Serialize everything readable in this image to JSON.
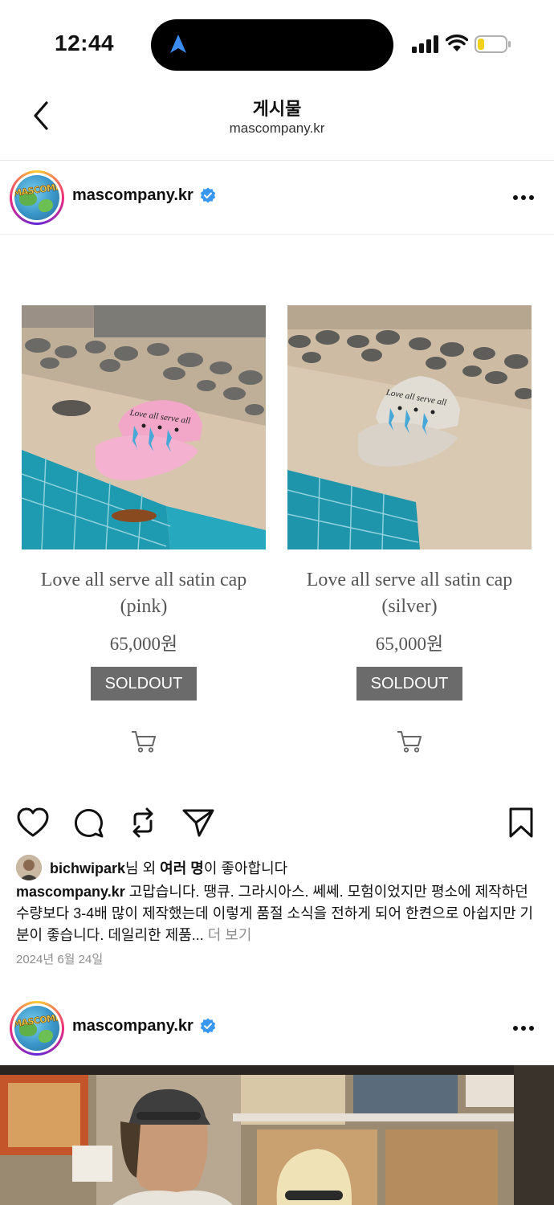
{
  "status_bar": {
    "time": "12:44"
  },
  "header": {
    "title": "게시물",
    "subtitle": "mascompany.kr",
    "back_icon": "chevron-left-icon"
  },
  "post": {
    "username": "mascompany.kr",
    "avatar_text": "MASCOMPANY",
    "verified": true,
    "products": [
      {
        "name_line1": "Love all serve all satin cap",
        "name_line2": "(pink)",
        "price": "65,000원",
        "status": "SOLDOUT",
        "cap_color": "#f2a7c8"
      },
      {
        "name_line1": "Love all serve all satin cap",
        "name_line2": "(silver)",
        "price": "65,000원",
        "status": "SOLDOUT",
        "cap_color": "#d8d2c8"
      }
    ],
    "cap_print_text": "Love all serve all",
    "likes": {
      "user": "bichwipark",
      "text1": "님 외 ",
      "bold": "여러 명",
      "text2": "이 좋아합니다"
    },
    "caption": {
      "username": "mascompany.kr",
      "text": " 고맙습니다. 땡큐. 그라시아스. 쎄쎄. 모험이었지만 평소에 제작하던 수량보다 3-4배 많이 제작했는데 이렇게 품절 소식을 전하게 되어 한켠으로 아쉽지만 기분이 좋습니다. 데일리한 제품... ",
      "more": "더 보기"
    },
    "date": "2024년 6월 24일"
  },
  "next_post": {
    "username": "mascompany.kr",
    "verified": true
  },
  "colors": {
    "accent_verified": "#3897f0",
    "soldout_bg": "#6b6b6b",
    "muted": "#8e8e8e"
  }
}
